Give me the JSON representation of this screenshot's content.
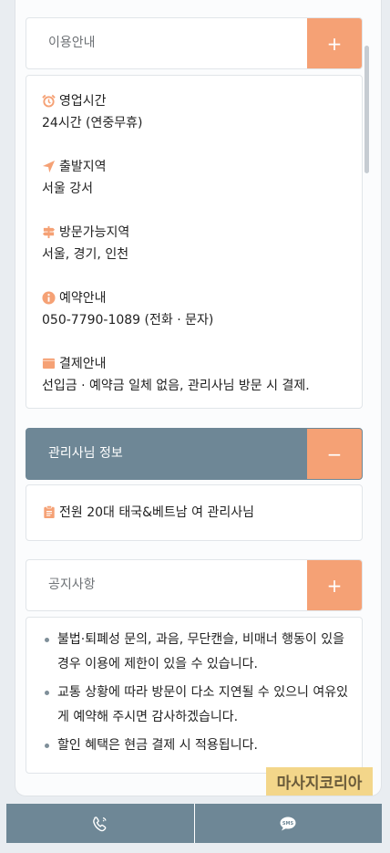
{
  "usage_section": {
    "title": "이용안내",
    "toggle": "+",
    "items": [
      {
        "icon": "alarm-clock-icon",
        "label": "영업시간",
        "value": "24시간 (연중무휴)"
      },
      {
        "icon": "location-arrow-icon",
        "label": "출발지역",
        "value": "서울 강서"
      },
      {
        "icon": "signpost-icon",
        "label": "방문가능지역",
        "value": "서울, 경기, 인천"
      },
      {
        "icon": "info-circle-icon",
        "label": "예약안내",
        "value": "050-7790-1089 (전화 · 문자)"
      },
      {
        "icon": "wallet-icon",
        "label": "결제안내",
        "value": "선입금 · 예약금 일체 없음, 관리사님 방문 시 결제."
      }
    ]
  },
  "manager_section": {
    "title": "관리사님 정보",
    "toggle": "−",
    "icon": "clipboard-icon",
    "text": "전원 20대 태국&베트남 여 관리사님"
  },
  "notice_section": {
    "title": "공지사항",
    "toggle": "+",
    "items": [
      "불법·퇴폐성 문의, 과음, 무단캔슬, 비매너 행동이 있을 경우 이용에 제한이 있을 수 있습니다.",
      "교통 상황에 따라 방문이 다소 지연될 수 있으니 여유있게 예약해 주시면 감사하겠습니다.",
      "할인 혜택은 현금 결제 시 적용됩니다."
    ]
  },
  "watermark": "마사지코리아",
  "bottom_bar": {
    "call_icon": "phone-ring-icon",
    "sms_icon": "sms-bubble-icon"
  },
  "colors": {
    "accent_orange": "#f5a175",
    "header_slate": "#6e8796"
  }
}
